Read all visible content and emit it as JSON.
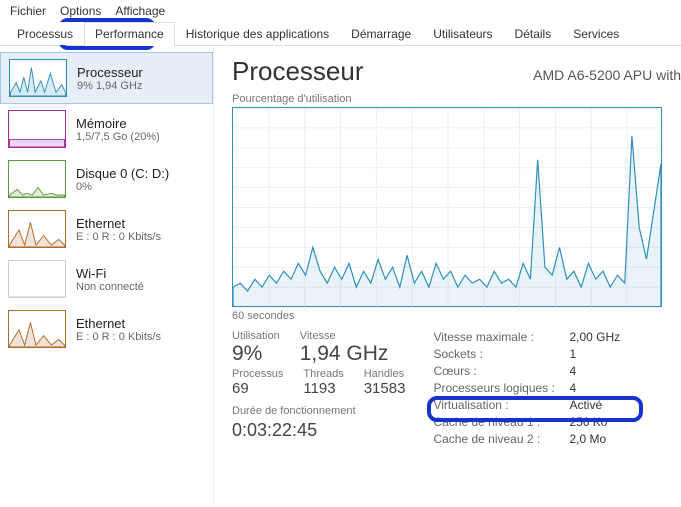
{
  "menubar": [
    "Fichier",
    "Options",
    "Affichage"
  ],
  "tabs": [
    "Processus",
    "Performance",
    "Historique des applications",
    "Démarrage",
    "Utilisateurs",
    "Détails",
    "Services"
  ],
  "active_tab_index": 1,
  "sidebar": [
    {
      "title": "Processeur",
      "sub": "9%  1,94 GHz",
      "color": "#2e8fbd",
      "kind": "cpu",
      "selected": true
    },
    {
      "title": "Mémoire",
      "sub": "1,5/7,5 Go (20%)",
      "color": "#a62da6",
      "kind": "mem"
    },
    {
      "title": "Disque 0 (C: D:)",
      "sub": "0%",
      "color": "#5b9a3b",
      "kind": "disk"
    },
    {
      "title": "Ethernet",
      "sub": "E : 0 R : 0 Kbits/s",
      "color": "#b06a2b",
      "kind": "net"
    },
    {
      "title": "Wi-Fi",
      "sub": "Non connecté",
      "color": "#cccccc",
      "kind": "wifi"
    },
    {
      "title": "Ethernet",
      "sub": "E : 0 R : 0 Kbits/s",
      "color": "#b06a2b",
      "kind": "net2"
    }
  ],
  "main": {
    "title": "Processeur",
    "cpu_name": "AMD A6-5200 APU with",
    "chart_top_label": "Pourcentage d'utilisation",
    "chart_bottom_label": "60 secondes",
    "metrics_big": [
      {
        "lbl": "Utilisation",
        "val": "9%"
      },
      {
        "lbl": "Vitesse",
        "val": "1,94 GHz"
      }
    ],
    "metrics_sm": [
      {
        "lbl": "Processus",
        "val": "69"
      },
      {
        "lbl": "Threads",
        "val": "1193"
      },
      {
        "lbl": "Handles",
        "val": "31583"
      }
    ],
    "uptime_lbl": "Durée de fonctionnement",
    "uptime_val": "0:03:22:45",
    "details": [
      {
        "lbl": "Vitesse maximale :",
        "val": "2,00 GHz"
      },
      {
        "lbl": "Sockets :",
        "val": "1"
      },
      {
        "lbl": "Cœurs :",
        "val": "4"
      },
      {
        "lbl": "Processeurs logiques :",
        "val": "4"
      },
      {
        "lbl": "Virtualisation :",
        "val": "Activé"
      },
      {
        "lbl": "Cache de niveau 1 :",
        "val": "256 Ko"
      },
      {
        "lbl": "Cache de niveau 2 :",
        "val": "2,0 Mo"
      }
    ]
  },
  "chart_data": {
    "type": "line",
    "ylim": [
      0,
      100
    ],
    "xlabel": "60 secondes",
    "ylabel": "Pourcentage d'utilisation",
    "values": [
      10,
      12,
      8,
      14,
      10,
      16,
      12,
      18,
      14,
      22,
      16,
      30,
      18,
      12,
      20,
      14,
      22,
      10,
      18,
      12,
      24,
      14,
      20,
      10,
      26,
      12,
      18,
      10,
      22,
      14,
      18,
      10,
      16,
      12,
      14,
      10,
      18,
      12,
      14,
      10,
      22,
      14,
      74,
      20,
      16,
      30,
      14,
      18,
      10,
      22,
      14,
      18,
      10,
      16,
      12,
      86,
      40,
      24,
      48,
      72
    ]
  }
}
